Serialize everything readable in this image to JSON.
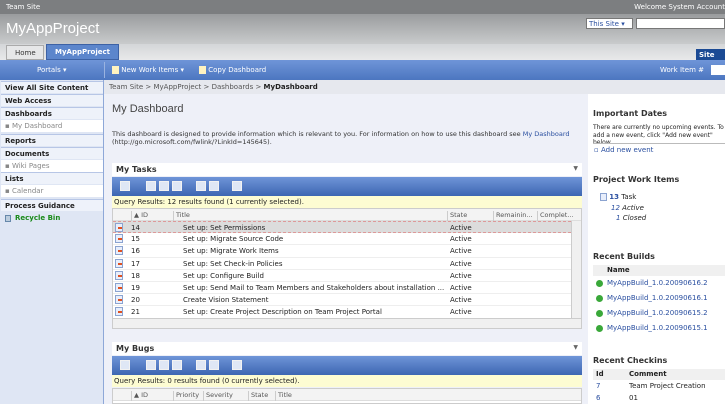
{
  "topbar": {
    "site": "Team Site",
    "welcome": "Welcome System Account"
  },
  "header": {
    "title": "MyAppProject",
    "scope": "This Site",
    "site_actions": "Site"
  },
  "tabs": [
    "Home",
    "MyAppProject"
  ],
  "navbar": {
    "portals": "Portals ▾",
    "new_work_items": "New Work Items ▾",
    "copy_dashboard": "Copy Dashboard",
    "work_item_label": "Work Item #"
  },
  "breadcrumb": {
    "path": "Team Site > MyAppProject > Dashboards > ",
    "current": "MyDashboard"
  },
  "leftnav": [
    {
      "label": "View All Site Content",
      "type": "h"
    },
    {
      "label": "Web Access",
      "type": "h"
    },
    {
      "label": "Dashboards",
      "type": "h"
    },
    {
      "label": "▪ My Dashboard",
      "type": "s"
    },
    {
      "label": "Reports",
      "type": "h"
    },
    {
      "label": "Documents",
      "type": "h"
    },
    {
      "label": "▪ Wiki Pages",
      "type": "s"
    },
    {
      "label": "Lists",
      "type": "h"
    },
    {
      "label": "▪ Calendar",
      "type": "s"
    },
    {
      "label": "Process Guidance",
      "type": "h"
    },
    {
      "label": "Recycle Bin",
      "type": "r"
    }
  ],
  "page": {
    "title": "My Dashboard",
    "desc": "This dashboard is designed to provide information which is relevant to you. For information on how to use this dashboard see ",
    "desc_link": "My Dashboard",
    "desc_tail": " (http://go.microsoft.com/fwlink/?LinkId=145645)."
  },
  "tasks": {
    "title": "My Tasks",
    "query": "Query Results: 12 results found (1 currently selected).",
    "columns": [
      "▲ ID",
      "Title",
      "State",
      "Remainin...",
      "Complet..."
    ],
    "rows": [
      [
        "14",
        "Set up: Set Permissions",
        "Active"
      ],
      [
        "15",
        "Set up: Migrate Source Code",
        "Active"
      ],
      [
        "16",
        "Set up: Migrate Work Items",
        "Active"
      ],
      [
        "17",
        "Set up: Set Check-in Policies",
        "Active"
      ],
      [
        "18",
        "Set up: Configure Build",
        "Active"
      ],
      [
        "19",
        "Set up: Send Mail to Team Members and Stakeholders about installation ...",
        "Active"
      ],
      [
        "20",
        "Create Vision Statement",
        "Active"
      ],
      [
        "21",
        "Set up: Create Project Description on Team Project Portal",
        "Active"
      ]
    ]
  },
  "bugs": {
    "title": "My Bugs",
    "query": "Query Results: 0 results found (0 currently selected).",
    "columns": [
      "▲ ID",
      "Priority",
      "Severity",
      "State",
      "Title"
    ]
  },
  "right": {
    "dates_title": "Important Dates",
    "dates_text": "There are currently no upcoming events. To add a new event, click \"Add new event\" below.",
    "add_event": "Add new event",
    "pwi_title": "Project Work Items",
    "task_count": "13",
    "task_label": "Task",
    "active_count": "12",
    "active_label": "Active",
    "closed_count": "1",
    "closed_label": "Closed",
    "builds_title": "Recent Builds",
    "builds_col": "Name",
    "builds": [
      "MyAppBuild_1.0.20090616.2",
      "MyAppBuild_1.0.20090616.1",
      "MyAppBuild_1.0.20090615.2",
      "MyAppBuild_1.0.20090615.1"
    ],
    "checkins_title": "Recent Checkins",
    "checkin_cols": [
      "Id",
      "Comment"
    ],
    "checkins": [
      [
        "7",
        "Team Project Creation"
      ],
      [
        "6",
        "01"
      ]
    ]
  }
}
